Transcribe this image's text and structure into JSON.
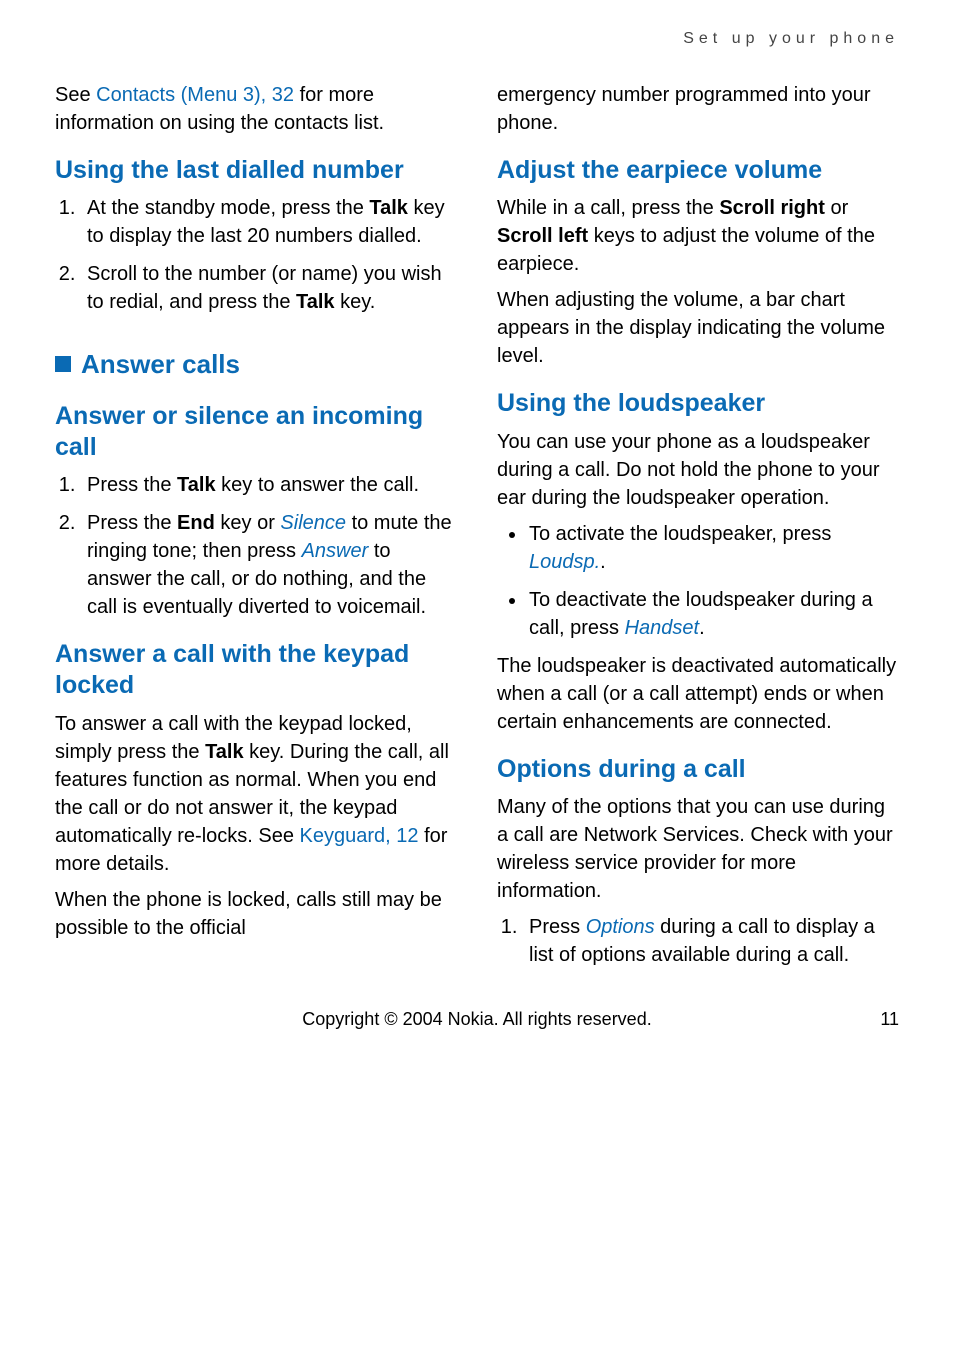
{
  "running_head": "Set up your phone",
  "left": {
    "intro_p1a": "See ",
    "intro_link": "Contacts (Menu 3), 32",
    "intro_p1b": " for more information on using the contacts list.",
    "h_last_dialled": "Using the last dialled number",
    "ld_step1a": "At the standby mode, press the ",
    "ld_step1_bold": "Talk",
    "ld_step1b": " key to display the last 20 numbers dialled.",
    "ld_step2a": "Scroll to the number (or name) you wish to redial, and press the ",
    "ld_step2_bold": "Talk",
    "ld_step2b": " key.",
    "h_answer_calls": "Answer calls",
    "h_answer_silence": "Answer or silence an incoming call",
    "as_step1a": "Press the ",
    "as_step1_bold": "Talk",
    "as_step1b": " key to answer the call.",
    "as_step2a": "Press the ",
    "as_step2_bold": "End",
    "as_step2b": " key or ",
    "as_step2_term1": "Silence",
    "as_step2c": " to mute the ringing tone; then press ",
    "as_step2_term2": "Answer",
    "as_step2d": " to answer the call, or do nothing, and the call is eventually diverted to voicemail.",
    "h_keypad_locked": "Answer a call with the keypad locked",
    "kl_p1a": "To answer a call with the keypad locked, simply press the ",
    "kl_p1_bold": "Talk",
    "kl_p1b": " key. During the call, all features function as normal. When you end the call or do not answer it, the keypad automatically re-locks. See ",
    "kl_link": "Keyguard, 12",
    "kl_p1c": " for more details.",
    "kl_p2": "When the phone is locked, calls still may be possible to the official"
  },
  "right": {
    "cont_p": "emergency number programmed into your phone.",
    "h_earpiece": "Adjust the earpiece volume",
    "ep_p1a": "While in a call, press the ",
    "ep_p1_bold1": "Scroll right",
    "ep_p1b": " or ",
    "ep_p1_bold2": "Scroll left",
    "ep_p1c": " keys to adjust the volume of the earpiece.",
    "ep_p2": "When adjusting the volume, a bar chart appears in the display indicating the volume level.",
    "h_loudspeaker": "Using the loudspeaker",
    "ls_p1": "You can use your phone as a loudspeaker during a call. Do not hold the phone to your ear during the loudspeaker operation.",
    "ls_b1a": "To activate the loudspeaker, press ",
    "ls_b1_term": "Loudsp.",
    "ls_b1b": ".",
    "ls_b2a": "To deactivate the loudspeaker during a call, press ",
    "ls_b2_term": "Handset",
    "ls_b2b": ".",
    "ls_p2": "The loudspeaker is deactivated automatically when a call (or a call attempt) ends or when certain enhancements are connected.",
    "h_options": "Options during a call",
    "op_p1": "Many of the options that you can use during a call are Network Services. Check with your wireless service provider for more information.",
    "op_s1a": "Press ",
    "op_s1_term": "Options",
    "op_s1b": " during a call to display a list of options available during a call."
  },
  "footer": {
    "copyright": "Copyright © 2004 Nokia. All rights reserved.",
    "page": "11"
  }
}
